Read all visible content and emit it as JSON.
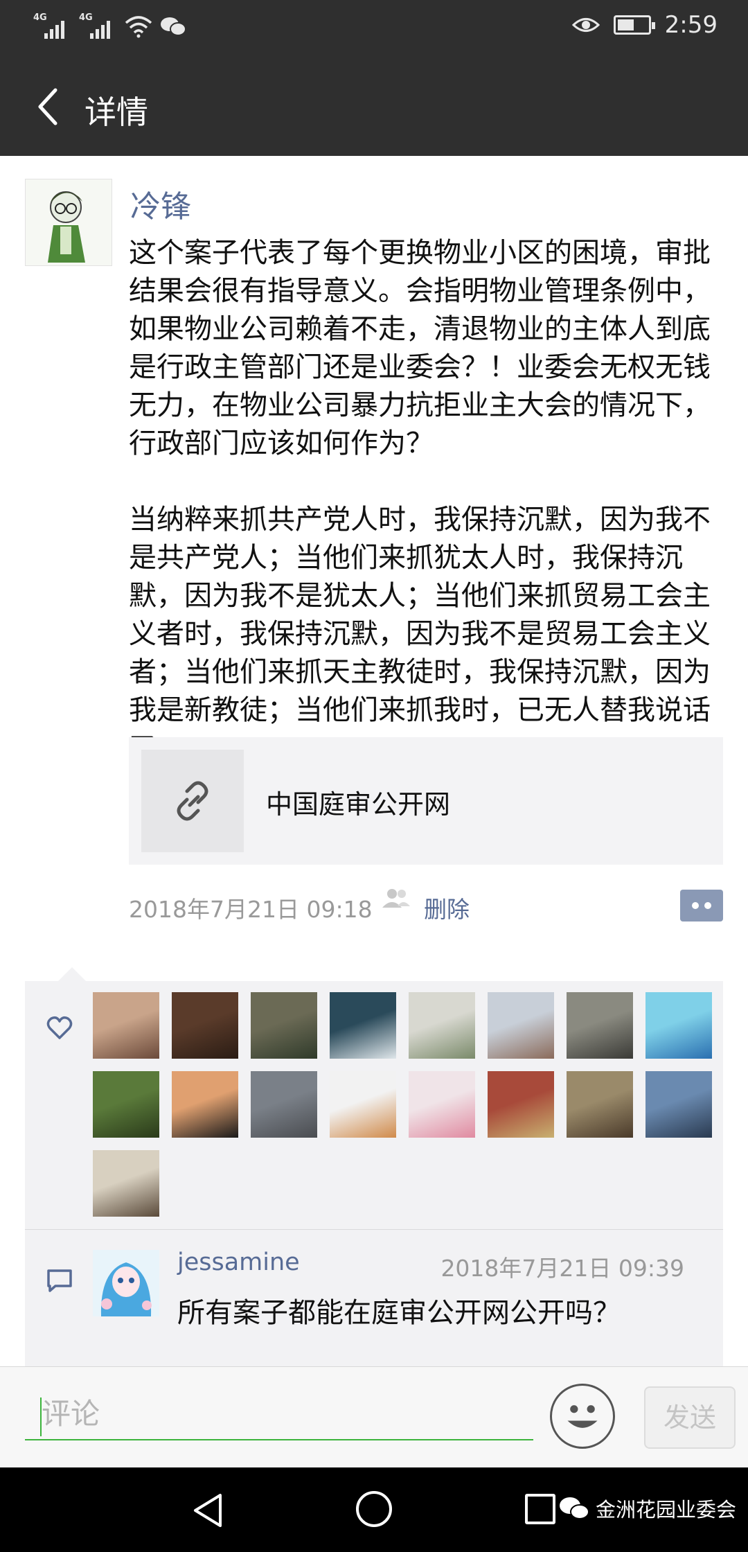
{
  "status_bar": {
    "network_1": "4G",
    "network_2": "4G",
    "time": "2:59",
    "battery_level": 0.55
  },
  "header": {
    "title": "详情"
  },
  "post": {
    "author": "冷锋",
    "text": "这个案子代表了每个更换物业小区的困境，审批结果会很有指导意义。会指明物业管理条例中，如果物业公司赖着不走，清退物业的主体人到底是行政主管部门还是业委会？！业委会无权无钱无力，在物业公司暴力抗拒业主大会的情况下，行政部门应该如何作为？\n\n当纳粹来抓共产党人时，我保持沉默，因为我不是共产党人；当他们来抓犹太人时，我保持沉默，因为我不是犹太人；当他们来抓贸易工会主义者时，我保持沉默，因为我不是贸易工会主义者；当他们来抓天主教徒时，我保持沉默，因为我是新教徒；当他们来抓我时，已无人替我说话了。",
    "link_title": "中国庭审公开网",
    "time": "2018年7月21日 09:18",
    "delete_label": "删除"
  },
  "likes": {
    "count": 17,
    "avatar_colors": [
      [
        "#c9a48a",
        "#6b4a3a"
      ],
      [
        "#5a3b2a",
        "#2a1c14"
      ],
      [
        "#6b6a55",
        "#2f3a2a"
      ],
      [
        "#2a4a5a",
        "#dfe6ea"
      ],
      [
        "#d8d8d0",
        "#7a8a6a"
      ],
      [
        "#c8cfd8",
        "#8a6a5a"
      ],
      [
        "#8a8a80",
        "#3a3a36"
      ],
      [
        "#7fd0e8",
        "#2a6fb0"
      ],
      [
        "#5a7a3a",
        "#2a3a1a"
      ],
      [
        "#e0a070",
        "#1a1a1a"
      ],
      [
        "#7a8088",
        "#4a4c50"
      ],
      [
        "#f2f2f2",
        "#d08a4a"
      ],
      [
        "#f0e4e8",
        "#e08aa0"
      ],
      [
        "#a84a3a",
        "#c8b070"
      ],
      [
        "#9a8a6a",
        "#4a3a2a"
      ],
      [
        "#6a8ab0",
        "#2a3a50"
      ],
      [
        "#d8d0c0",
        "#5a4a3a"
      ]
    ]
  },
  "comments": [
    {
      "user": "jessamine",
      "time": "2018年7月21日 09:39",
      "text": "所有案子都能在庭审公开网公开吗？"
    }
  ],
  "input": {
    "placeholder": "评论",
    "send_label": "发送"
  },
  "watermark": {
    "text": "金洲花园业委会"
  },
  "colors": {
    "dark_bar": "#2f2f2f",
    "link_blue": "#576b95",
    "accent_green": "#3cb43c",
    "panel_bg": "#f2f2f4"
  }
}
